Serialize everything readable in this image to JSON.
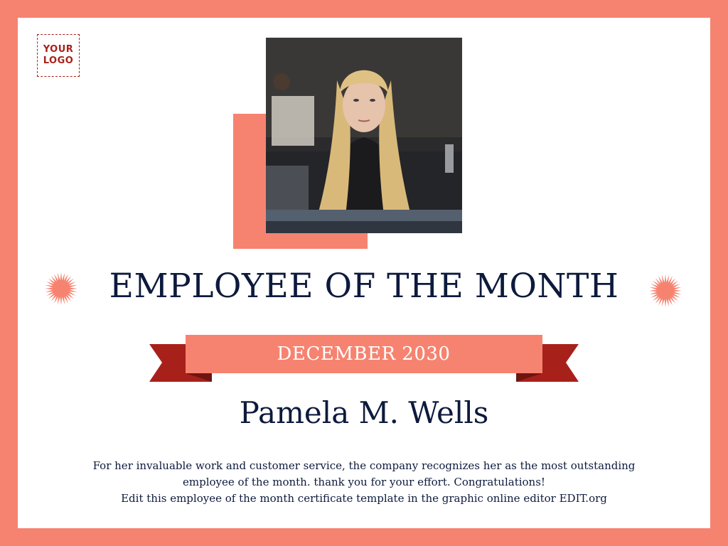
{
  "logo": {
    "line1": "YOUR",
    "line2": "LOGO"
  },
  "photo": {
    "icon": "employee-portrait-photo"
  },
  "certificate": {
    "title": "EMPLOYEE OF THE MONTH",
    "date": "DECEMBER 2030",
    "recipient": "Pamela M. Wells",
    "body_line1": "For her invaluable work and customer service, the company recognizes her as the most outstanding employee of the month. thank you for your effort. Congratulations!",
    "body_line2": "Edit this employee of the month certificate template in the graphic online editor EDIT.org"
  },
  "colors": {
    "frame": "#f68370",
    "navy": "#0d1a3d",
    "dark_red": "#a8201a",
    "white": "#ffffff"
  }
}
